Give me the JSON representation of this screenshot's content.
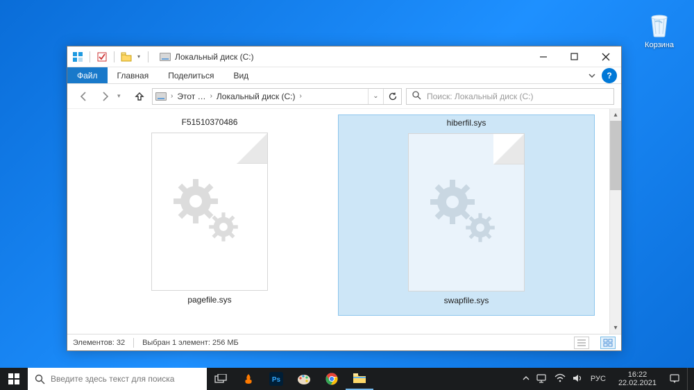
{
  "desktop": {
    "recycle_label": "Корзина"
  },
  "window": {
    "title": "Локальный диск (C:)",
    "ribbon": {
      "file": "Файл",
      "home": "Главная",
      "share": "Поделиться",
      "view": "Вид"
    },
    "breadcrumb": {
      "this_pc": "Этот …",
      "drive": "Локальный диск (C:)"
    },
    "search_placeholder": "Поиск: Локальный диск (C:)",
    "files": [
      {
        "top_label": "F51510370486",
        "bottom_label": "pagefile.sys",
        "selected": false
      },
      {
        "top_label": "hiberfil.sys",
        "bottom_label": "swapfile.sys",
        "selected": true
      }
    ],
    "status": {
      "count": "Элементов: 32",
      "selection": "Выбран 1 элемент: 256 МБ"
    }
  },
  "taskbar": {
    "search_placeholder": "Введите здесь текст для поиска",
    "lang": "РУС",
    "time": "16:22",
    "date": "22.02.2021"
  }
}
